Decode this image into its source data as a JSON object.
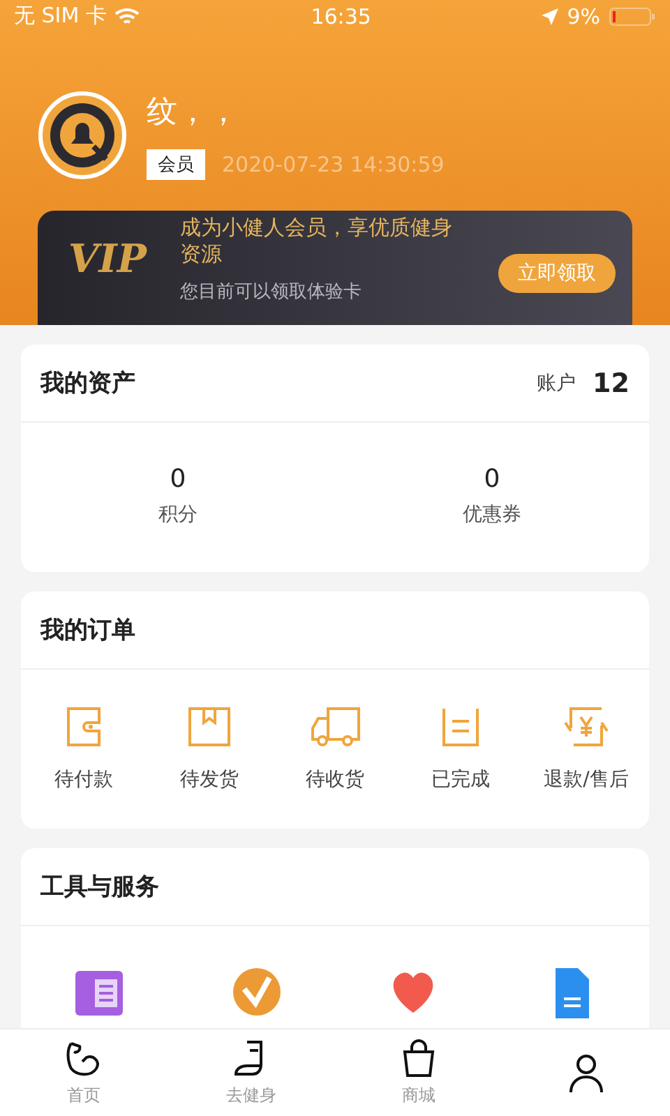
{
  "status_bar": {
    "carrier": "无 SIM 卡",
    "time": "16:35",
    "battery": "9%"
  },
  "profile": {
    "name": "纹，，",
    "badge": "会员",
    "date": "2020-07-23 14:30:59"
  },
  "vip": {
    "logo": "VIP",
    "title": "成为小健人会员，享优质健身资源",
    "subtitle": "您目前可以领取体验卡",
    "button": "立即领取"
  },
  "assets": {
    "title": "我的资产",
    "account_label": "账户",
    "account_value": "12",
    "stats": [
      {
        "value": "0",
        "label": "积分"
      },
      {
        "value": "0",
        "label": "优惠券"
      }
    ]
  },
  "orders": {
    "title": "我的订单",
    "items": [
      {
        "kind": "wallet",
        "label": "待付款"
      },
      {
        "kind": "box",
        "label": "待发货"
      },
      {
        "kind": "truck",
        "label": "待收货"
      },
      {
        "kind": "list",
        "label": "已完成"
      },
      {
        "kind": "refund",
        "label": "退款/售后"
      }
    ]
  },
  "tools": {
    "title": "工具与服务",
    "items": [
      {
        "kind": "book"
      },
      {
        "kind": "check"
      },
      {
        "kind": "heart"
      },
      {
        "kind": "doc"
      }
    ]
  },
  "tab_bar": [
    {
      "kind": "arm",
      "label": "首页"
    },
    {
      "kind": "shoe",
      "label": "去健身"
    },
    {
      "kind": "bag",
      "label": "商城"
    },
    {
      "kind": "person"
    }
  ]
}
